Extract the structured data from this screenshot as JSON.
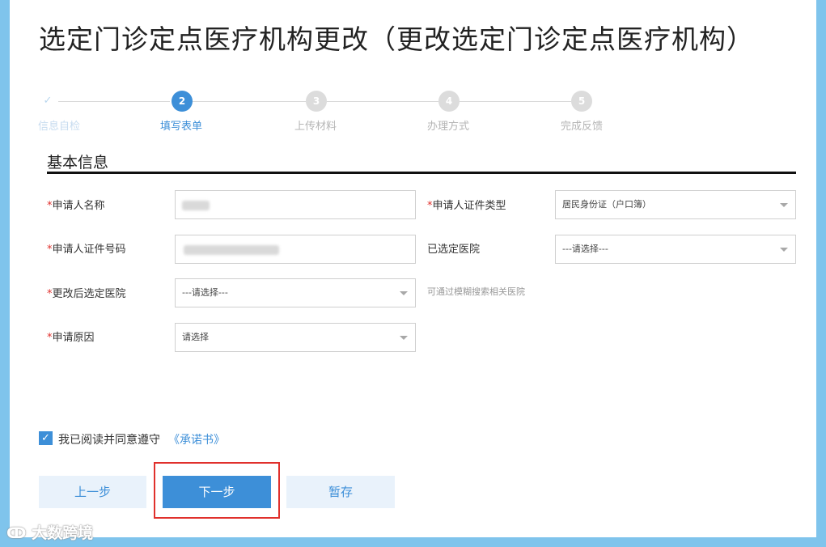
{
  "title": "选定门诊定点医疗机构更改（更改选定门诊定点医疗机构）",
  "steps": [
    {
      "num": "✓",
      "label": "信息自检",
      "state": "done"
    },
    {
      "num": "2",
      "label": "填写表单",
      "state": "active"
    },
    {
      "num": "3",
      "label": "上传材料",
      "state": "todo"
    },
    {
      "num": "4",
      "label": "办理方式",
      "state": "todo"
    },
    {
      "num": "5",
      "label": "完成反馈",
      "state": "todo"
    }
  ],
  "section": {
    "title": "基本信息"
  },
  "form": {
    "required_mark": "*",
    "applicant_name": {
      "label": "申请人名称"
    },
    "id_type": {
      "label": "申请人证件类型",
      "value": "居民身份证（户口簿）"
    },
    "id_number": {
      "label": "申请人证件号码"
    },
    "selected_hospital": {
      "label": "已选定医院",
      "placeholder": "---请选择---"
    },
    "new_hospital": {
      "label": "更改后选定医院",
      "placeholder": "---请选择---",
      "hint": "可通过模糊搜索相关医院"
    },
    "reason": {
      "label": "申请原因",
      "placeholder": "请选择"
    }
  },
  "agreement": {
    "checked": true,
    "text": "我已阅读并同意遵守",
    "link": "《承诺书》"
  },
  "buttons": {
    "prev": "上一步",
    "next": "下一步",
    "save": "暂存"
  },
  "watermark": "大数跨境",
  "colors": {
    "accent": "#3d8fd8",
    "required": "#e0302c",
    "highlight": "#e0302c",
    "frame": "#7fc4ec"
  }
}
